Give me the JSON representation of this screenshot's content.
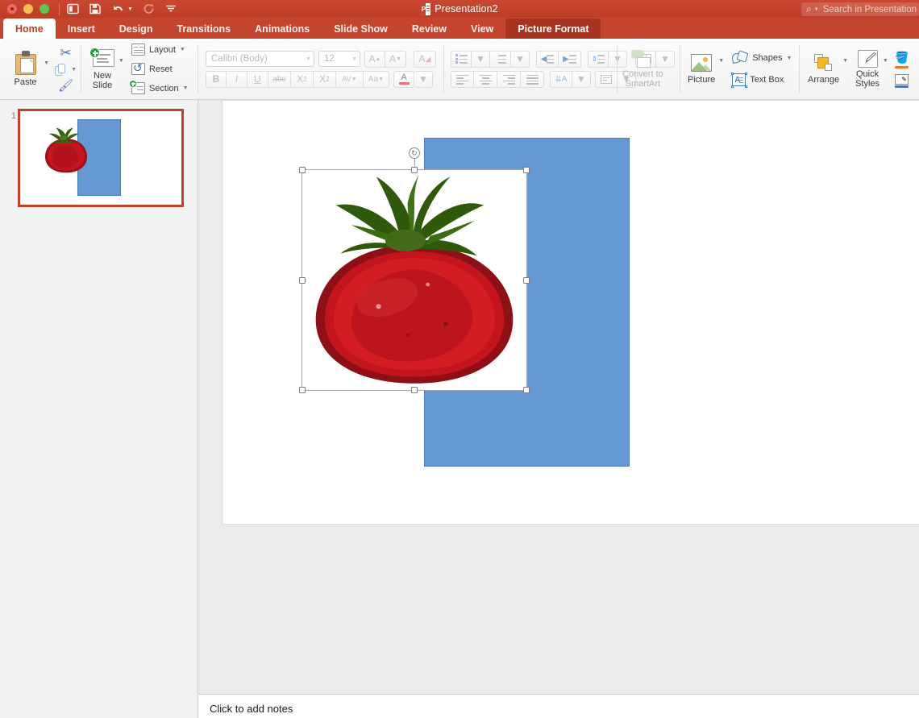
{
  "titlebar": {
    "document_title": "Presentation2",
    "window_controls": [
      "close",
      "minimize",
      "zoom"
    ],
    "quick_access": [
      {
        "name": "sidebar-toggle",
        "label": "Sidebar"
      },
      {
        "name": "save",
        "label": "Save"
      },
      {
        "name": "undo",
        "label": "Undo"
      },
      {
        "name": "redo",
        "label": "Redo"
      },
      {
        "name": "customize",
        "label": "Customize Toolbar"
      }
    ],
    "search_placeholder": "Search in Presentation"
  },
  "tabs": [
    {
      "label": "Home",
      "active": true
    },
    {
      "label": "Insert",
      "active": false
    },
    {
      "label": "Design",
      "active": false
    },
    {
      "label": "Transitions",
      "active": false
    },
    {
      "label": "Animations",
      "active": false
    },
    {
      "label": "Slide Show",
      "active": false
    },
    {
      "label": "Review",
      "active": false
    },
    {
      "label": "View",
      "active": false
    },
    {
      "label": "Picture Format",
      "active": false,
      "contextual": true
    }
  ],
  "ribbon": {
    "clipboard": {
      "paste_label": "Paste",
      "cut_label": "Cut",
      "copy_label": "Copy",
      "format_painter_label": "Format Painter"
    },
    "slides": {
      "new_slide_label": "New\nSlide",
      "new_slide_line1": "New",
      "new_slide_line2": "Slide",
      "layout_label": "Layout",
      "reset_label": "Reset",
      "section_label": "Section"
    },
    "font": {
      "font_name": "Calibri (Body)",
      "font_size": "12",
      "grow_label": "A",
      "shrink_label": "A",
      "clear_formatting_label": "A",
      "bold_label": "B",
      "italic_label": "I",
      "underline_label": "U",
      "strikethrough_label": "abc",
      "superscript_label": "X",
      "subscript_label": "X",
      "spacing_label": "AV",
      "change_case_label": "Aa",
      "font_color_label": "A",
      "enabled": false
    },
    "paragraph": {
      "bullets_label": "Bullets",
      "numbering_label": "Numbering",
      "decrease_indent_label": "Decrease Indent",
      "increase_indent_label": "Increase Indent",
      "line_spacing_label": "Line Spacing",
      "columns_label": "Columns",
      "align_left_label": "Align Left",
      "align_center_label": "Center",
      "align_right_label": "Align Right",
      "justify_label": "Justify",
      "text_direction_label": "Text Direction",
      "align_text_label": "Align Text",
      "enabled": false
    },
    "smartart": {
      "line1": "Convert to",
      "line2": "SmartArt",
      "enabled": false
    },
    "insert": {
      "picture_label": "Picture",
      "shapes_label": "Shapes",
      "textbox_label": "Text Box"
    },
    "drawing": {
      "arrange_label": "Arrange",
      "quick_styles_line1": "Quick",
      "quick_styles_line2": "Styles",
      "shape_fill_label": "Shape Fill",
      "shape_outline_label": "Shape Outline"
    }
  },
  "thumbnails": {
    "slides": [
      {
        "number": "1",
        "selected": true
      }
    ]
  },
  "slide": {
    "shapes": [
      {
        "name": "blue-rectangle",
        "type": "rectangle",
        "fill": "#6699D1",
        "stroke": "#4a7cb5"
      },
      {
        "name": "tomato-picture",
        "type": "image",
        "selected": true,
        "subject": "tomato"
      }
    ],
    "selection": {
      "handles": 8,
      "rotation_handle": true
    }
  },
  "notes": {
    "placeholder": "Click to add notes"
  },
  "colors": {
    "ribbon_red": "#c4452e",
    "contextual_tab": "#a6341f",
    "thumbnail_border": "#c0412a",
    "shape_blue": "#6699D1",
    "tomato_red": "#b81b22",
    "stem_green": "#3d6b1e"
  }
}
